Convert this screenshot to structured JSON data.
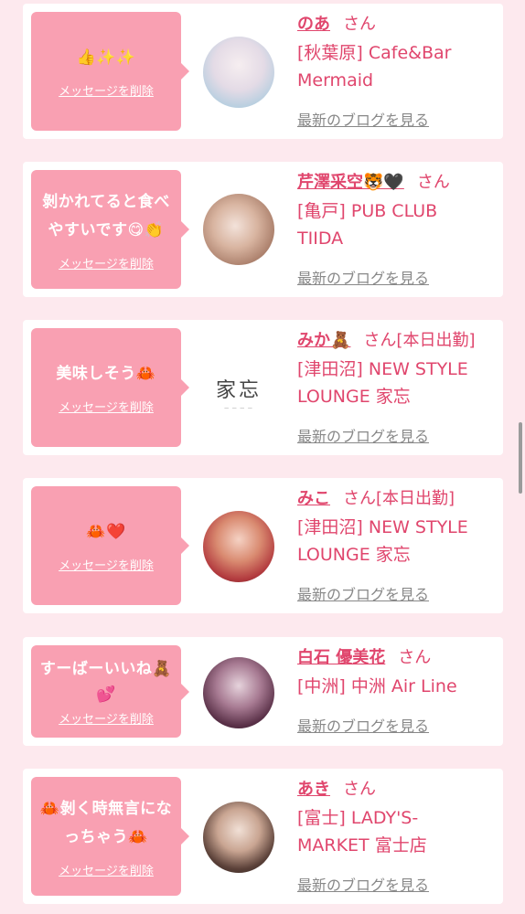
{
  "delete_label": "メッセージを削除",
  "blog_label": "最新のブログを見る",
  "honorific": "さん",
  "cards": [
    {
      "message_lines": [
        "👍✨✨"
      ],
      "name": "のあ",
      "status": "",
      "shop_lines": [
        "[秋葉原] Cafe&Bar",
        "Mermaid"
      ]
    },
    {
      "message_lines": [
        "剝かれてると食べ",
        "やすいです😋👏"
      ],
      "name": "芹澤采空🐯🖤",
      "status": "",
      "shop_lines": [
        "[亀戸] PUB CLUB",
        "TIIDA"
      ]
    },
    {
      "message_lines": [
        "美味しそう🦀"
      ],
      "name": "みか🧸",
      "status": "[本日出勤]",
      "shop_lines": [
        "[津田沼] NEW STYLE",
        "LOUNGE 家忘"
      ],
      "avatar_logo": "家忘"
    },
    {
      "message_lines": [
        "🦀❤️"
      ],
      "name": "みこ",
      "status": "[本日出勤]",
      "shop_lines": [
        "[津田沼] NEW STYLE",
        "LOUNGE 家忘"
      ]
    },
    {
      "message_lines": [
        "すーばーいいね🧸",
        "💕"
      ],
      "name": "白石 優美花",
      "status": "",
      "shop_lines": [
        "[中洲] 中洲 Air Line"
      ]
    },
    {
      "message_lines": [
        "🦀剝く時無言にな",
        "っちゃう🦀"
      ],
      "name": "あき",
      "status": "",
      "shop_lines": [
        "[富士] LADY'S-",
        "MARKET 富士店"
      ]
    }
  ]
}
